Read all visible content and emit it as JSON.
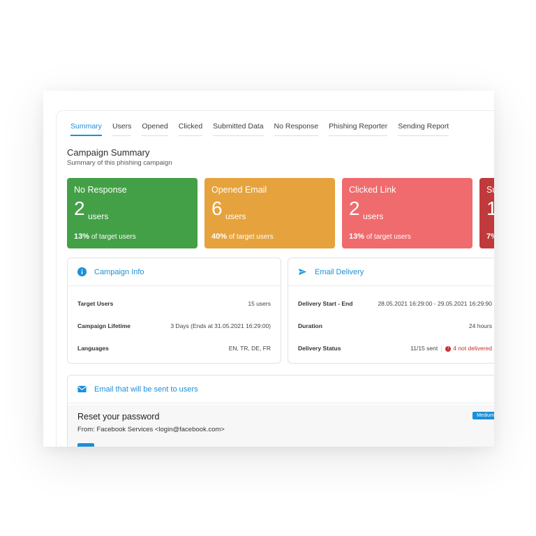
{
  "tabs": [
    "Summary",
    "Users",
    "Opened",
    "Clicked",
    "Submitted Data",
    "No Response",
    "Phishing Reporter",
    "Sending Report"
  ],
  "header": {
    "title": "Campaign Summary",
    "subtitle": "Summary of this phishing campaign"
  },
  "cards": [
    {
      "title": "No Response",
      "number": "2",
      "unit": "users",
      "percent": "13%",
      "percent_text": "of target users",
      "color": "#43a047"
    },
    {
      "title": "Opened Email",
      "number": "6",
      "unit": "users",
      "percent": "40%",
      "percent_text": "of target users",
      "color": "#e6a23c"
    },
    {
      "title": "Clicked Link",
      "number": "2",
      "unit": "users",
      "percent": "13%",
      "percent_text": "of target users",
      "color": "#f06b6d"
    },
    {
      "title": "Su",
      "number": "1",
      "unit": "",
      "percent": "7%",
      "percent_text": "",
      "color": "#c0393b"
    }
  ],
  "campaign_info": {
    "title": "Campaign Info",
    "icon": "info-icon",
    "rows": [
      {
        "label": "Target Users",
        "value": "15 users"
      },
      {
        "label": "Campaign Lifetime",
        "value": "3 Days (Ends at 31.05.2021 16:29:00)"
      },
      {
        "label": "Languages",
        "value": "EN, TR, DE, FR"
      }
    ]
  },
  "email_delivery": {
    "title": "Email Delivery",
    "icon": "send-icon",
    "rows": [
      {
        "label": "Delivery Start - End",
        "value": "28.05.2021 16:29:00 - 29.05.2021 16:29:90"
      },
      {
        "label": "Duration",
        "value": "24 hours"
      },
      {
        "label": "Delivery Status",
        "value": "11/15 sent",
        "error": "4 not delivered"
      }
    ]
  },
  "email_preview": {
    "title": "Email that will be sent to users",
    "icon": "envelope-icon",
    "subject": "Reset your password",
    "from": "From: Facebook Services <login@facebook.com>",
    "badge": "Medium"
  },
  "colors": {
    "accent": "#1b8fd8",
    "error": "#c9302c"
  }
}
